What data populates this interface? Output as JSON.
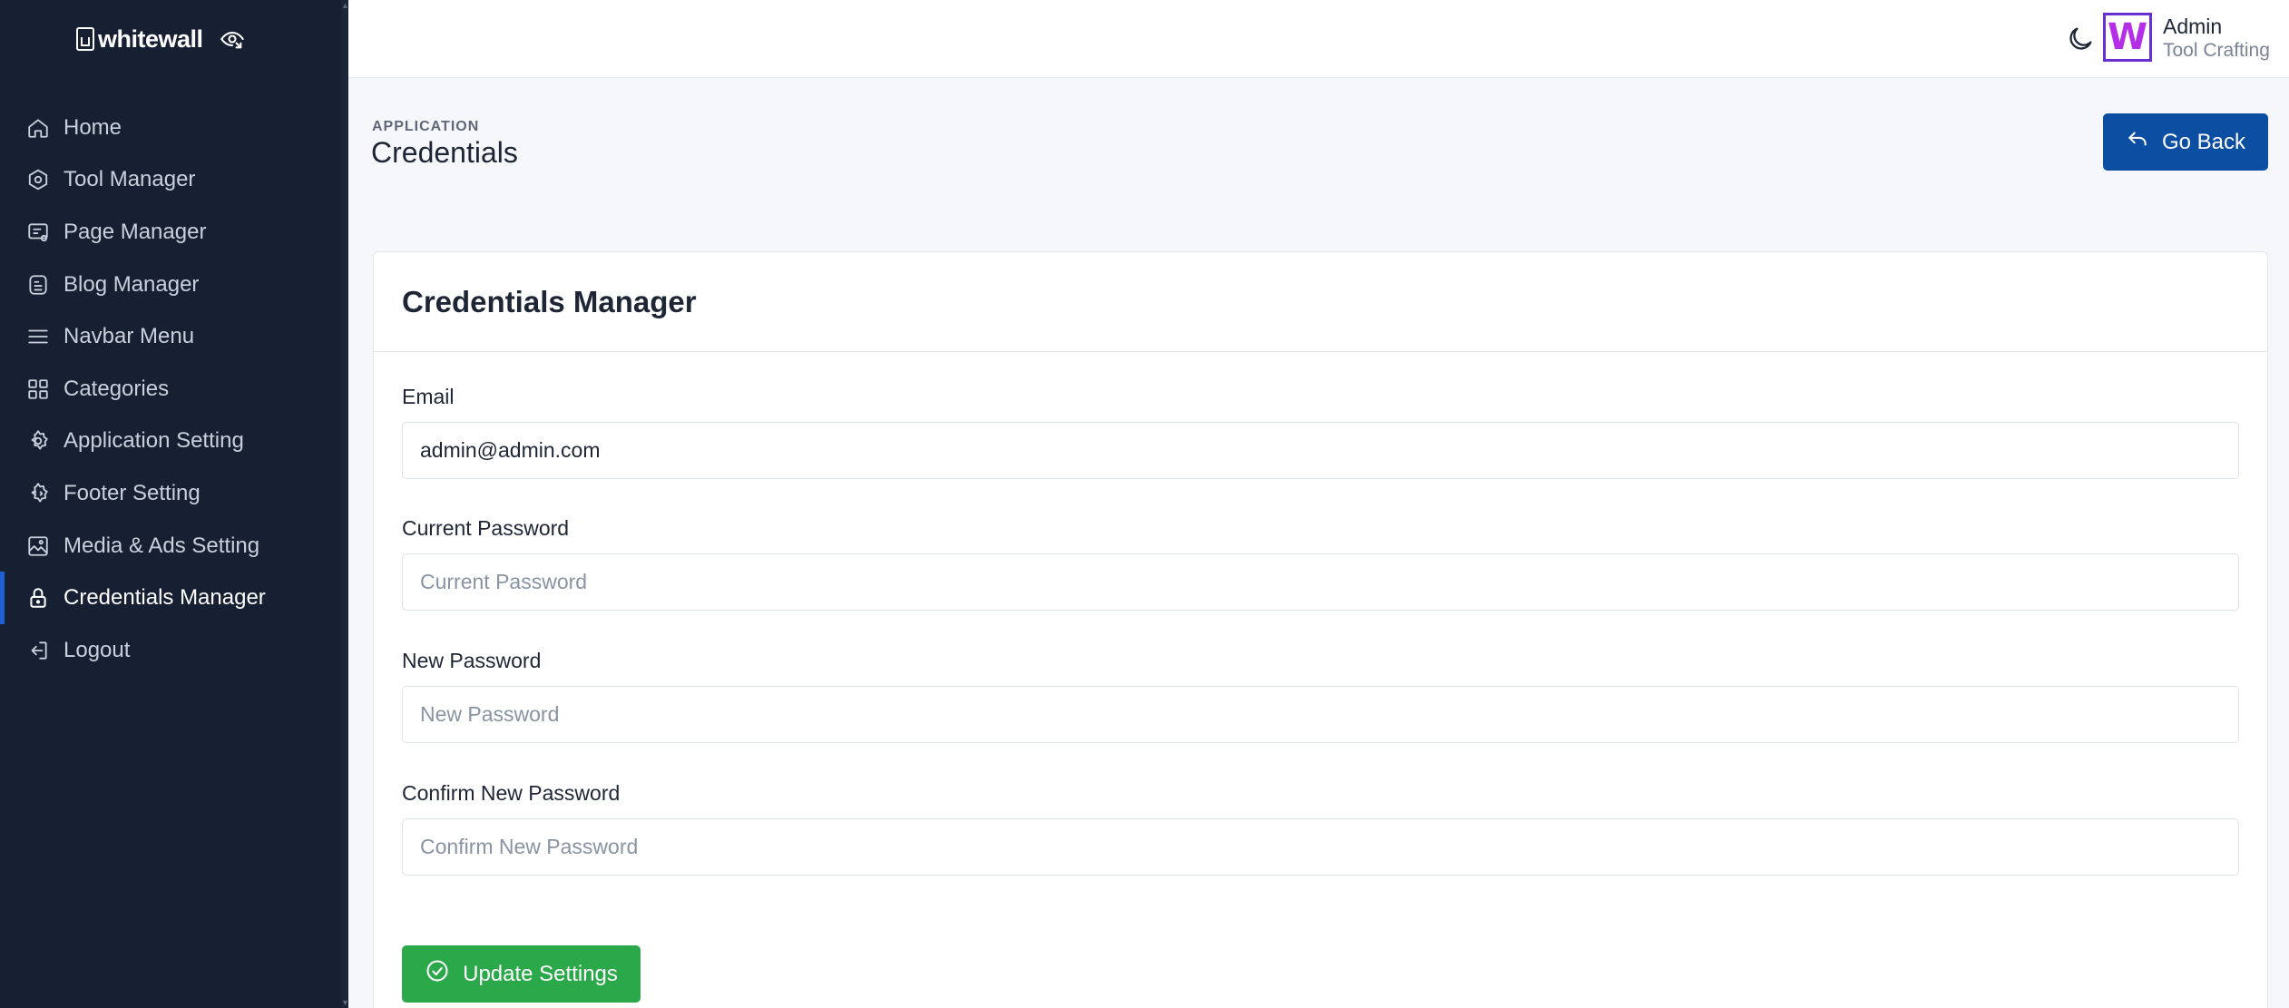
{
  "brand": {
    "name": "whitewall"
  },
  "sidebar": {
    "items": [
      {
        "label": "Home",
        "icon": "home-icon"
      },
      {
        "label": "Tool Manager",
        "icon": "hexagon-icon"
      },
      {
        "label": "Page Manager",
        "icon": "page-settings-icon"
      },
      {
        "label": "Blog Manager",
        "icon": "blog-icon"
      },
      {
        "label": "Navbar Menu",
        "icon": "menu-icon"
      },
      {
        "label": "Categories",
        "icon": "grid-icon"
      },
      {
        "label": "Application Setting",
        "icon": "gear-icon"
      },
      {
        "label": "Footer Setting",
        "icon": "gear-code-icon"
      },
      {
        "label": "Media & Ads Setting",
        "icon": "image-icon"
      },
      {
        "label": "Credentials Manager",
        "icon": "lock-icon",
        "active": true
      },
      {
        "label": "Logout",
        "icon": "logout-icon"
      }
    ]
  },
  "header": {
    "avatar_letter": "W",
    "user_name": "Admin",
    "user_org": "Tool Crafting"
  },
  "page": {
    "eyebrow": "APPLICATION",
    "title": "Credentials",
    "go_back": "Go Back"
  },
  "card": {
    "title": "Credentials Manager",
    "email": {
      "label": "Email",
      "value": "admin@admin.com"
    },
    "current_password": {
      "label": "Current Password",
      "placeholder": "Current Password"
    },
    "new_password": {
      "label": "New Password",
      "placeholder": "New Password"
    },
    "confirm_password": {
      "label": "Confirm New Password",
      "placeholder": "Confirm New Password"
    },
    "submit": "Update Settings"
  },
  "colors": {
    "sidebar_bg": "#172033",
    "accent_blue": "#0c4ea2",
    "success_green": "#2aa84a",
    "active_indicator": "#1e5fd6",
    "avatar_purple": "#6b2fd1"
  }
}
